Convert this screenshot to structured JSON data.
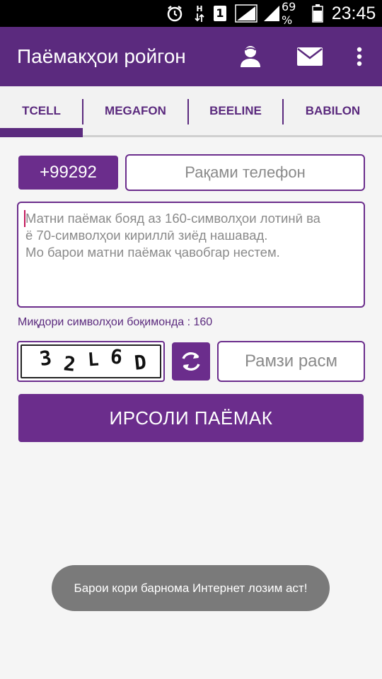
{
  "status_bar": {
    "icons": [
      "alarm-icon",
      "data-arrows-icon",
      "sim-1-icon",
      "signal-icon",
      "signal-icon",
      "battery-icon"
    ],
    "data_letter": "H",
    "sim_label": "1",
    "battery": "69 %",
    "time": "23:45"
  },
  "app_bar": {
    "title": "Паёмакҳои ройгон",
    "icons": [
      "person-icon",
      "envelope-icon",
      "more-vert-icon"
    ]
  },
  "tabs": [
    {
      "label": "TCELL",
      "selected": true
    },
    {
      "label": "MEGAFON",
      "selected": false
    },
    {
      "label": "BEELINE",
      "selected": false
    },
    {
      "label": "BABILON",
      "selected": false
    }
  ],
  "form": {
    "prefix": "+99292",
    "phone_placeholder": "Рақами телефон",
    "message_placeholder_line1": "Матни паёмак бояд аз 160-символҳои лотинӣ ва",
    "message_placeholder_line2": "ё 70-символҳои кириллӣ зиёд нашавад.",
    "message_placeholder_line3": "Мо барои матни паёмак ҷавобгар нестем.",
    "counter_text": "Миқдори символҳои боқимонда : 160",
    "captcha_chars": [
      "3",
      "2",
      "L",
      "6",
      "D"
    ],
    "captcha_placeholder": "Рамзи расм",
    "send_label": "ИРСОЛИ ПАЁМАК"
  },
  "toast": {
    "text": "Барои кори барнома Интернет лозим аст!"
  },
  "colors": {
    "primary": "#5b2a7e",
    "accent": "#6b2d8c",
    "background": "#f5f5f5",
    "toast": "#7a7a7a"
  }
}
